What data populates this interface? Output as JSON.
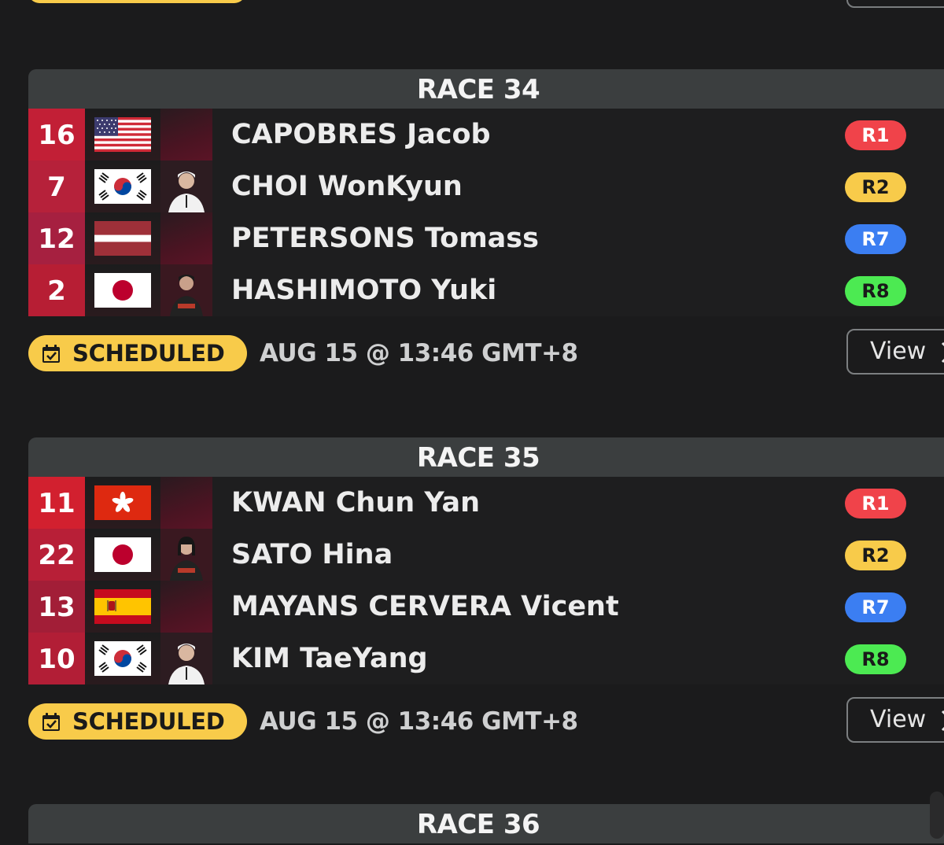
{
  "colors": {
    "background": "#1b1b1c",
    "header_bg": "#3b3e3f",
    "scheduled": "#f8cb4a",
    "r1": "#f0434a",
    "r2": "#f8cb4a",
    "r7": "#3b7ef2",
    "r8": "#4cea52"
  },
  "races": [
    {
      "title": "RACE 34",
      "status": "SCHEDULED",
      "time": "AUG 15 @ 13:46 GMT+8",
      "view_label": "View",
      "entries": [
        {
          "number": "16",
          "flag": "usa-flag",
          "photo": false,
          "name": "CAPOBRES Jacob",
          "badge": "R1"
        },
        {
          "number": "7",
          "flag": "korea-flag",
          "photo": true,
          "name": "CHOI WonKyun",
          "badge": "R2"
        },
        {
          "number": "12",
          "flag": "latvia-flag",
          "photo": false,
          "name": "PETERSONS Tomass",
          "badge": "R7"
        },
        {
          "number": "2",
          "flag": "japan-flag",
          "photo": true,
          "name": "HASHIMOTO Yuki",
          "badge": "R8"
        }
      ]
    },
    {
      "title": "RACE 35",
      "status": "SCHEDULED",
      "time": "AUG 15 @ 13:46 GMT+8",
      "view_label": "View",
      "entries": [
        {
          "number": "11",
          "flag": "hong-kong-flag",
          "photo": false,
          "name": "KWAN Chun Yan",
          "badge": "R1"
        },
        {
          "number": "22",
          "flag": "japan-flag",
          "photo": true,
          "name": "SATO Hina",
          "badge": "R2"
        },
        {
          "number": "13",
          "flag": "spain-flag",
          "photo": false,
          "name": "MAYANS CERVERA Vicent",
          "badge": "R7"
        },
        {
          "number": "10",
          "flag": "korea-flag",
          "photo": true,
          "name": "KIM TaeYang",
          "badge": "R8"
        }
      ]
    },
    {
      "title": "RACE 36"
    }
  ]
}
